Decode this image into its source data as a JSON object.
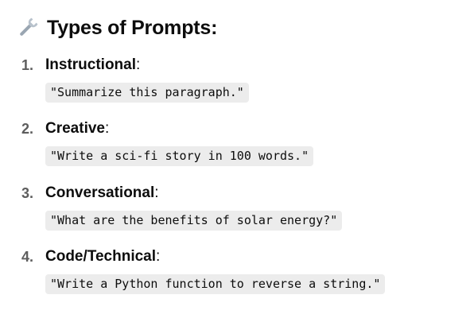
{
  "heading": {
    "icon": "wrench-icon",
    "title": "Types of Prompts:"
  },
  "items": [
    {
      "number": "1.",
      "label": "Instructional",
      "suffix": ":",
      "example": "\"Summarize this paragraph.\""
    },
    {
      "number": "2.",
      "label": "Creative",
      "suffix": ":",
      "example": "\"Write a sci-fi story in 100 words.\""
    },
    {
      "number": "3.",
      "label": "Conversational",
      "suffix": ":",
      "example": "\"What are the benefits of solar energy?\""
    },
    {
      "number": "4.",
      "label": "Code/Technical",
      "suffix": ":",
      "example": "\"Write a Python function to reverse a string.\""
    }
  ]
}
